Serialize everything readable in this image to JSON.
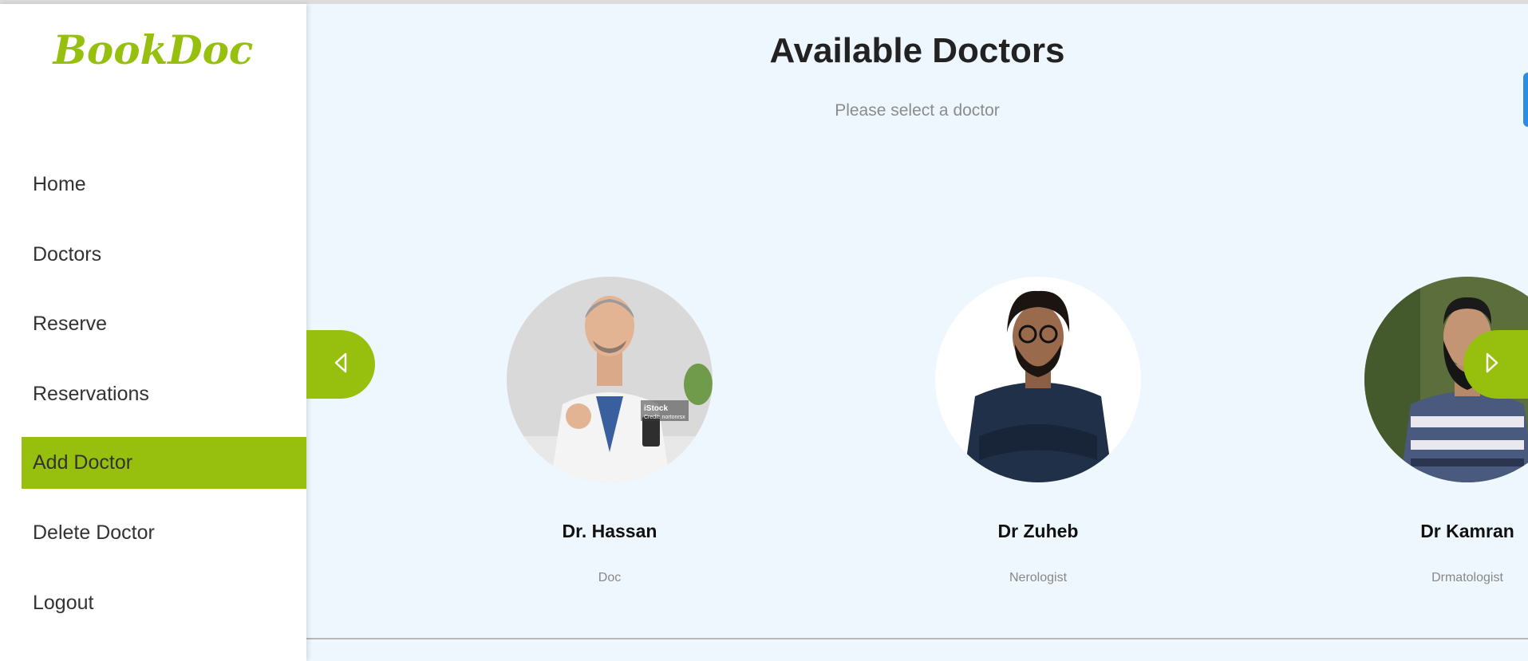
{
  "app": {
    "logo_text": "BookDoc"
  },
  "sidebar": {
    "items": [
      {
        "label": "Home"
      },
      {
        "label": "Doctors"
      },
      {
        "label": "Reserve"
      },
      {
        "label": "Reservations"
      },
      {
        "label": "Add Doctor",
        "active": true
      },
      {
        "label": "Delete Doctor"
      },
      {
        "label": "Logout"
      }
    ]
  },
  "main": {
    "title": "Available Doctors",
    "subtitle": "Please select a doctor"
  },
  "carousel": {
    "prev_icon": "chevron-left-icon",
    "next_icon": "chevron-right-icon",
    "doctors": [
      {
        "name": "Dr. Hassan",
        "specialty": "Doc"
      },
      {
        "name": "Dr Zuheb",
        "specialty": "Nerologist"
      },
      {
        "name": "Dr Kamran",
        "specialty": "Drmatologist"
      }
    ]
  },
  "colors": {
    "accent": "#97bf0d",
    "main_background": "#eef6fe"
  }
}
